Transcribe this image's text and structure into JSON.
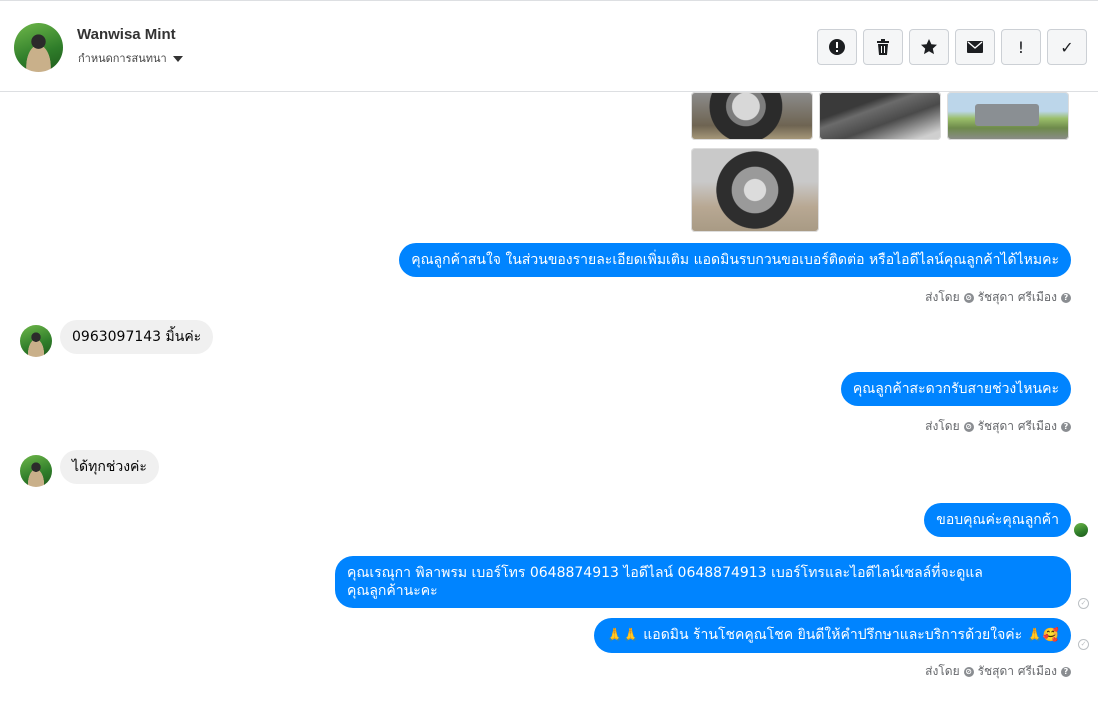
{
  "header": {
    "contact_name": "Wanwisa Mint",
    "assign_label": "กำหนดการสนทนา"
  },
  "toolbar": {
    "buttons": [
      {
        "name": "spam-button",
        "icon": "alert-circle-icon"
      },
      {
        "name": "delete-button",
        "icon": "trash-icon"
      },
      {
        "name": "star-button",
        "icon": "star-icon"
      },
      {
        "name": "mark-unread-button",
        "icon": "envelope-icon"
      },
      {
        "name": "follow-up-button",
        "icon": "exclamation-icon",
        "glyph": "!"
      },
      {
        "name": "done-button",
        "icon": "checkmark-icon",
        "glyph": "✓"
      }
    ]
  },
  "messages": {
    "m1": "คุณลูกค้าสนใจ ในส่วนของรายละเอียดเพิ่มเติม แอดมินรบกวนขอเบอร์ติดต่อ หรือไอดีไลน์คุณลูกค้าได้ไหมคะ",
    "m2": "0963097143 มิ้นค่ะ",
    "m3": "คุณลูกค้าสะดวกรับสายช่วงไหนคะ",
    "m4": "ได้ทุกช่วงค่ะ",
    "m5": "ขอบคุณค่ะคุณลูกค้า",
    "m6_line1": "คุณเรณุกา พิลาพรม        เบอร์โทร 0648874913  ไอดีไลน์ 0648874913   เบอร์โทรและไอดีไลน์เซลล์ที่จะดูแล",
    "m6_line2": "คุณลูกค้านะคะ",
    "m7_prefix": "🙏🙏",
    "m7": "แอดมิน ร้านโชคคูณโชค ยินดีให้คำปรึกษาและบริการด้วยใจค่ะ",
    "m7_suffix": "🙏🥰"
  },
  "sent_by": {
    "prefix": "ส่งโดย",
    "agent": "รัชสุดา ศรีเมือง",
    "help": "?"
  },
  "colors": {
    "outgoing": "#0084ff",
    "incoming": "#f0f0f0",
    "meta": "#65676b"
  }
}
